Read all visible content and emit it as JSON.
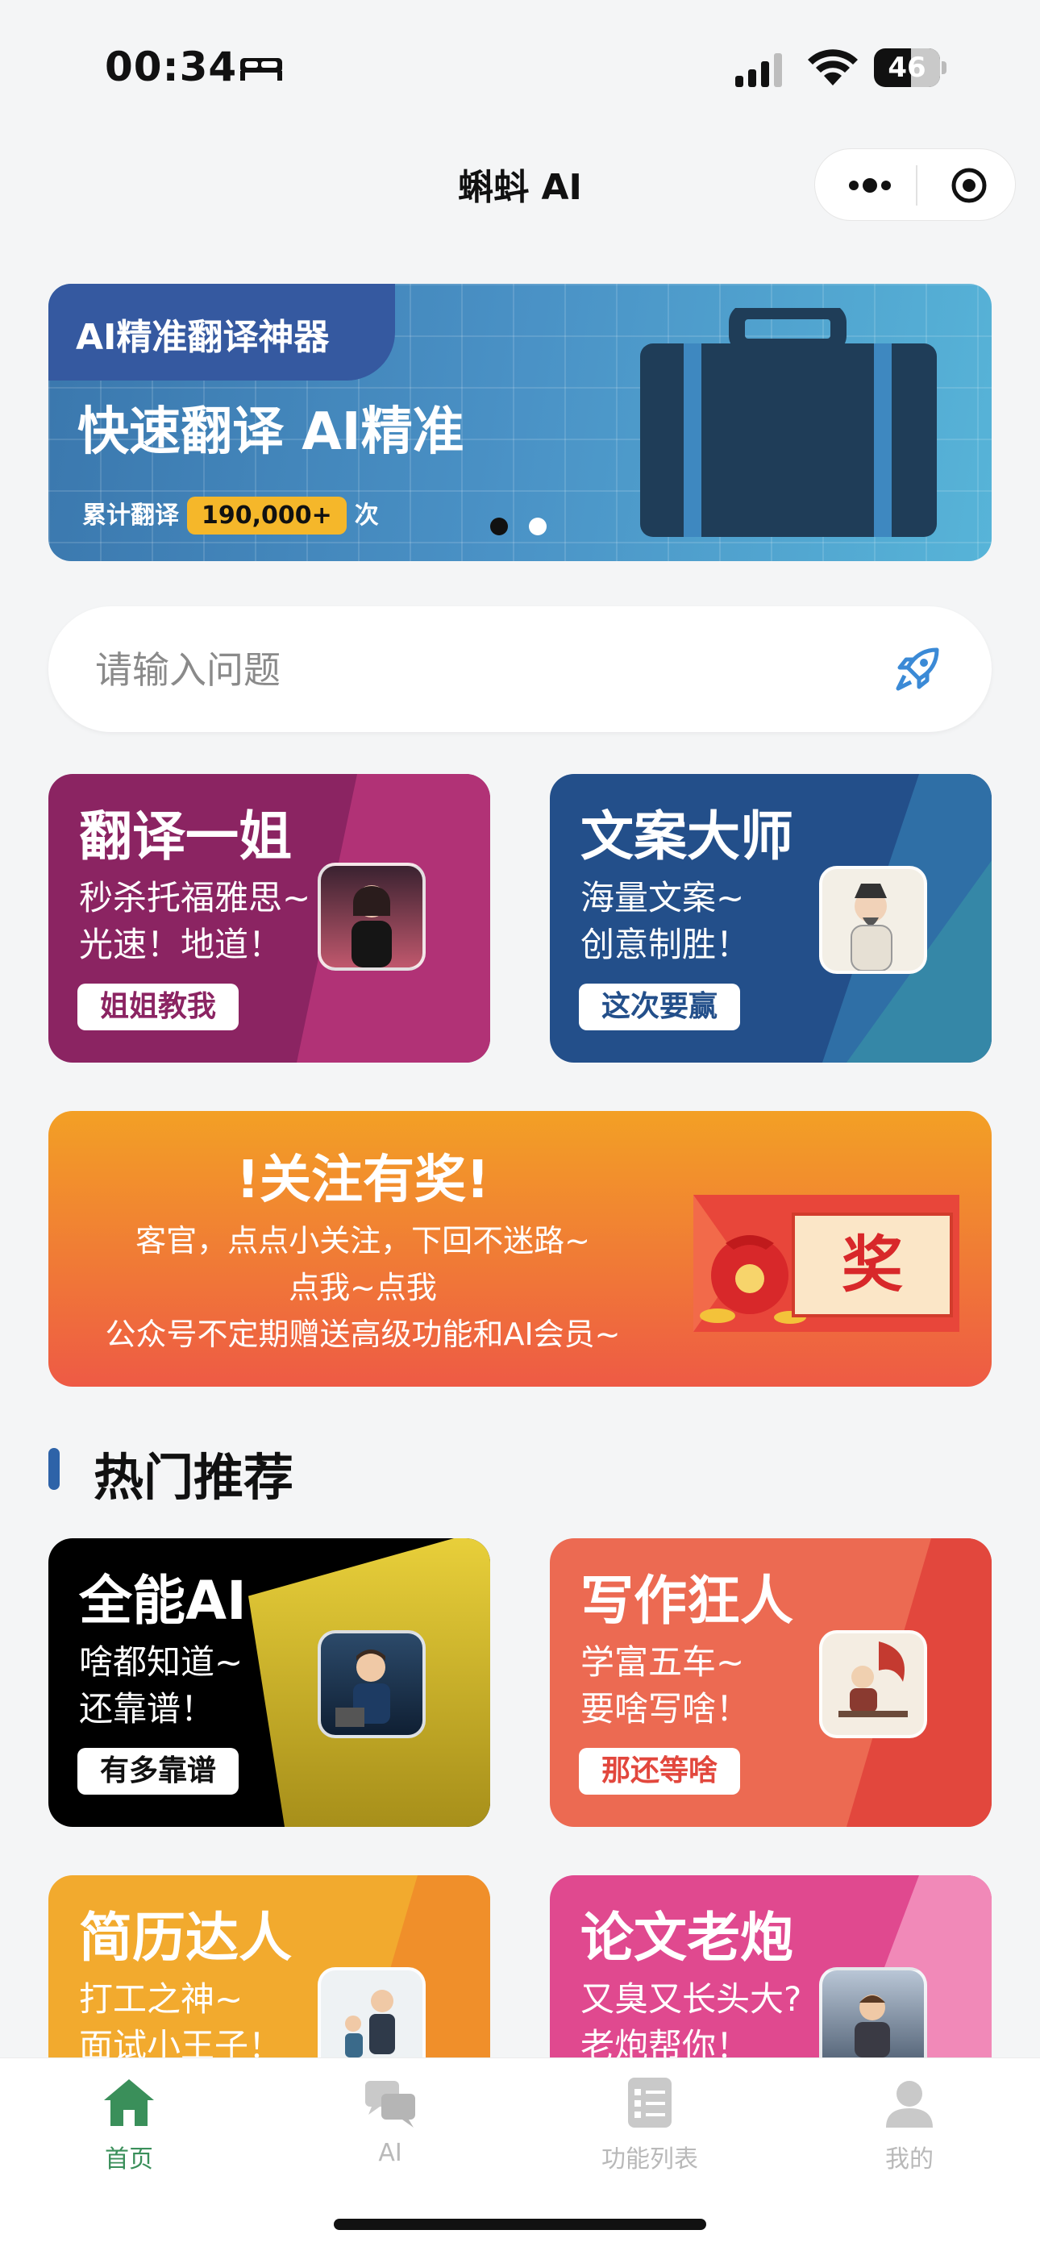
{
  "status_bar": {
    "time": "00:34",
    "battery": "46"
  },
  "nav": {
    "title": "蝌蚪 AI"
  },
  "banner": {
    "tag": "AI精准翻译神器",
    "title": "快速翻译 AI精准",
    "count_prefix": "累计翻译",
    "count": "190,000+",
    "count_suffix": "次"
  },
  "search": {
    "placeholder": "请输入问题"
  },
  "cards_top": [
    {
      "title": "翻译一姐",
      "line1": "秒杀托福雅思~",
      "line2": "光速！地道！",
      "button": "姐姐教我",
      "bg": "#8b2462",
      "accent": "#b13276",
      "btn_color": "#8b2462"
    },
    {
      "title": "文案大师",
      "line1": "海量文案~",
      "line2": "创意制胜！",
      "button": "这次要赢",
      "bg": "#234f8a",
      "accent": "#2f6fa6",
      "btn_color": "#234f8a"
    }
  ],
  "promo": {
    "title": "!关注有奖!",
    "line1": "客官，点点小关注，下回不迷路~",
    "line2": "点我~点我",
    "line3": "公众号不定期赠送高级功能和AI会员~",
    "stamp": "奖"
  },
  "section": {
    "title": "热门推荐"
  },
  "cards_hot": [
    {
      "title": "全能AI",
      "line1": "啥都知道~",
      "line2": "还靠谱！",
      "button": "有多靠谱",
      "bg": "#000000",
      "accent": "#d9c12a",
      "btn_color": "#111111"
    },
    {
      "title": "写作狂人",
      "line1": "学富五车~",
      "line2": "要啥写啥！",
      "button": "那还等啥",
      "bg": "#ec6a52",
      "accent": "#e2473d",
      "btn_color": "#e2473d"
    },
    {
      "title": "简历达人",
      "line1": "打工之神~",
      "line2": "面试小王子！",
      "button": "",
      "bg": "#f2aa2e",
      "accent": "#f08f2a",
      "btn_color": "#f08f2a"
    },
    {
      "title": "论文老炮",
      "line1": "又臭又长头大?",
      "line2": "老炮帮你！",
      "button": "",
      "bg": "#e0498f",
      "accent": "#f189b8",
      "btn_color": "#e0498f"
    }
  ],
  "tabbar": {
    "items": [
      {
        "label": "首页",
        "icon": "home-icon",
        "active": true
      },
      {
        "label": "AI",
        "icon": "chat-icon",
        "active": false
      },
      {
        "label": "功能列表",
        "icon": "list-icon",
        "active": false
      },
      {
        "label": "我的",
        "icon": "user-icon",
        "active": false
      }
    ],
    "active_color": "#3a8f5a"
  },
  "colors": {
    "banner_tag": "#3559a0",
    "count_badge": "#f5b72a",
    "section_bar": "#2e63a8"
  }
}
